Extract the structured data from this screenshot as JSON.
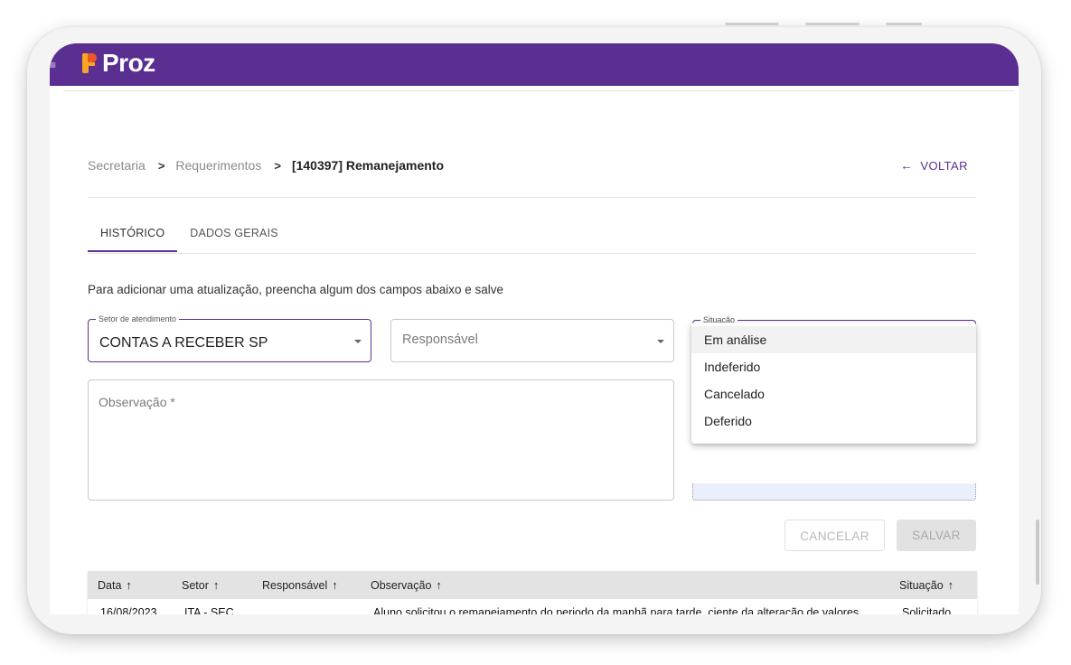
{
  "brand": {
    "name": "Proz",
    "bar_color": "#5b2f91"
  },
  "menu_icon": "hamburger-icon",
  "breadcrumb": {
    "items": [
      "Secretaria",
      "Requerimentos",
      "[140397] Remanejamento"
    ],
    "separator": ">"
  },
  "back": {
    "label": "VOLTAR",
    "icon": "arrow-left-icon"
  },
  "tabs": [
    {
      "label": "HISTÓRICO",
      "active": true
    },
    {
      "label": "DADOS GERAIS",
      "active": false
    }
  ],
  "instructions": "Para adicionar uma atualização, preencha algum dos campos abaixo e salve",
  "form": {
    "setor": {
      "label": "Setor de atendimento",
      "value": "CONTAS A RECEBER SP"
    },
    "responsavel": {
      "placeholder": "Responsável"
    },
    "situacao": {
      "label": "Situação",
      "value": ""
    },
    "observacao": {
      "placeholder": "Observação *"
    }
  },
  "situacao_options": [
    "Em análise",
    "Indeferido",
    "Cancelado",
    "Deferido"
  ],
  "buttons": {
    "cancel": "CANCELAR",
    "save": "SALVAR"
  },
  "table": {
    "columns": [
      "Data",
      "Setor",
      "Responsável",
      "Observação",
      "Situação"
    ],
    "sort_icon": "↑",
    "rows": [
      {
        "data": "16/08/2023",
        "setor": "ITA - SEC",
        "responsavel": "",
        "observacao": "Aluno solicitou o remanejamento do periodo da manhã para tarde, ciente da alteração de valores.",
        "situacao": "Solicitado"
      }
    ]
  }
}
